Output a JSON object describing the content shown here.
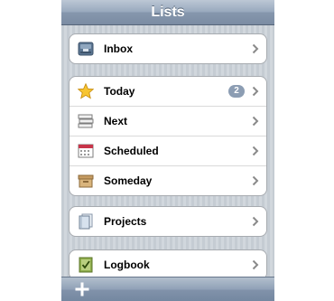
{
  "navbar": {
    "title": "Lists"
  },
  "groups": [
    {
      "items": [
        {
          "label": "Inbox",
          "icon": "inbox-tray-icon"
        }
      ]
    },
    {
      "items": [
        {
          "label": "Today",
          "icon": "star-icon",
          "badge": "2"
        },
        {
          "label": "Next",
          "icon": "stacked-trays-icon"
        },
        {
          "label": "Scheduled",
          "icon": "calendar-icon"
        },
        {
          "label": "Someday",
          "icon": "box-icon"
        }
      ]
    },
    {
      "items": [
        {
          "label": "Projects",
          "icon": "notebook-icon"
        }
      ]
    },
    {
      "items": [
        {
          "label": "Logbook",
          "icon": "logbook-check-icon"
        }
      ]
    }
  ],
  "toolbar": {
    "add_icon": "plus-icon"
  },
  "colors": {
    "navbar": "#8c9db3",
    "badge": "#8c9db3",
    "background_stripe": "#c5ccd3"
  }
}
